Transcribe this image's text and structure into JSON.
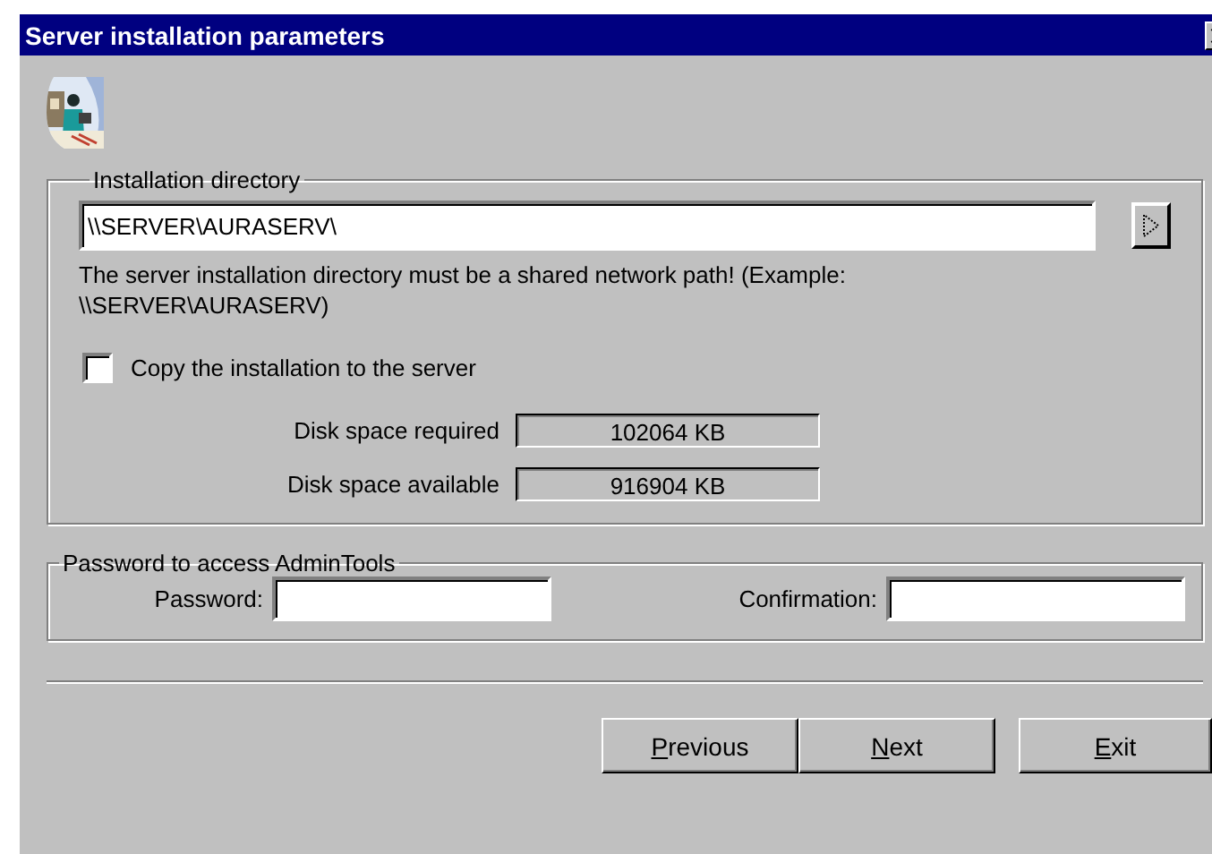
{
  "window": {
    "title": "Server installation parameters"
  },
  "installation_directory": {
    "legend": "Installation directory",
    "path": "\\\\SERVER\\AURASERV\\",
    "hint": "The server installation directory must be a shared network path! (Example: \\\\SERVER\\AURASERV)",
    "copy_checkbox": {
      "label": "Copy the installation to the server",
      "checked": false
    },
    "disk_space": [
      {
        "label": "Disk space required",
        "value": "102064 KB"
      },
      {
        "label": "Disk space available",
        "value": "916904 KB"
      }
    ]
  },
  "password_group": {
    "legend": "Password to access AdminTools",
    "fields": [
      {
        "label": "Password:"
      },
      {
        "label": "Confirmation:"
      }
    ]
  },
  "buttons": [
    {
      "label": "Previous"
    },
    {
      "label": "Next"
    },
    {
      "label": "Exit"
    }
  ]
}
